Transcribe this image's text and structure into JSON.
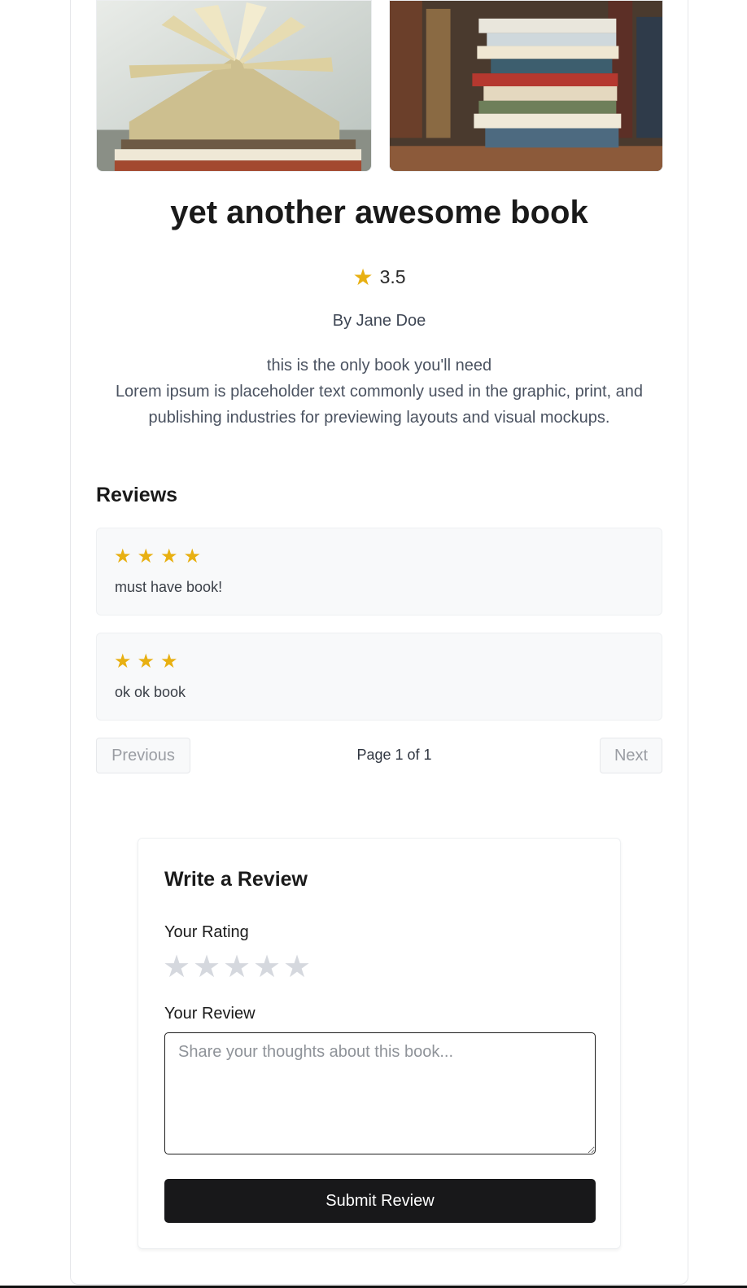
{
  "book": {
    "title": "yet another awesome book",
    "rating_icon": "star-icon",
    "rating": "3.5",
    "author": "By Jane Doe",
    "tagline": "this is the only book you'll need",
    "description": "Lorem ipsum is placeholder text commonly used in the graphic, print, and publishing industries for previewing layouts and visual mockups.",
    "images": [
      {
        "name": "open-book-photo"
      },
      {
        "name": "book-stack-photo"
      }
    ]
  },
  "reviews": {
    "heading": "Reviews",
    "items": [
      {
        "stars": "★★★★",
        "rating": 4,
        "text": "must have book!"
      },
      {
        "stars": "★★★",
        "rating": 3,
        "text": "ok ok book"
      }
    ],
    "pagination": {
      "previous_label": "Previous",
      "page_indicator": "Page 1 of 1",
      "next_label": "Next"
    }
  },
  "review_form": {
    "title": "Write a Review",
    "rating_label": "Your Rating",
    "rating_stars": [
      "★",
      "★",
      "★",
      "★",
      "★"
    ],
    "selected_rating": 0,
    "review_label": "Your Review",
    "review_placeholder": "Share your thoughts about this book...",
    "review_value": "",
    "submit_label": "Submit Review"
  },
  "colors": {
    "star_filled": "#e8b012",
    "star_empty": "#d5d8de",
    "submit_bg": "#18181a",
    "review_bg": "#f8f9fa"
  }
}
